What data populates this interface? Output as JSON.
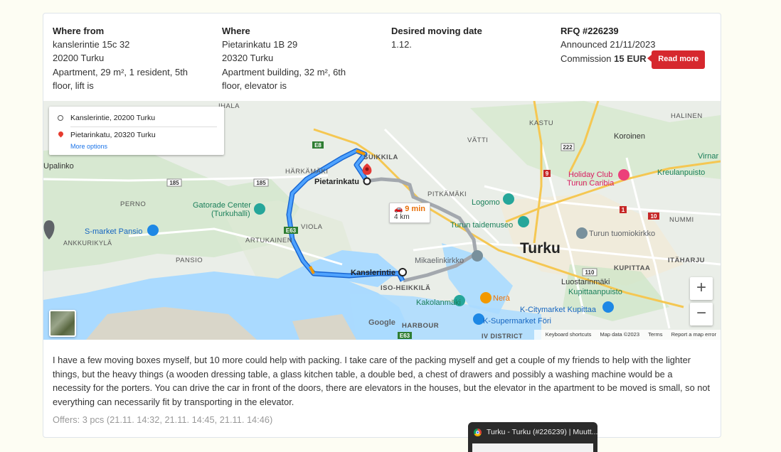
{
  "from": {
    "heading": "Where from",
    "street": "kanslerintie 15c 32",
    "city": "20200 Turku",
    "details": "Apartment, 29 m², 1 resident, 5th floor, lift is"
  },
  "to": {
    "heading": "Where",
    "street": "Pietarinkatu 1B 29",
    "city": "20320 Turku",
    "details": "Apartment building, 32 m², 6th floor, elevator is"
  },
  "date": {
    "heading": "Desired moving date",
    "value": "1.12."
  },
  "rfq": {
    "heading": "RFQ #226239",
    "announced": "Announced 21/11/2023",
    "commission_label": "Commission",
    "commission_value": "15 EUR",
    "read_more": "Read more"
  },
  "map": {
    "origin": "Kanslerintie, 20200 Turku",
    "destination": "Pietarinkatu, 20320 Turku",
    "more_options": "More options",
    "duration": "9 min",
    "distance": "4 km",
    "zoom_in": "+",
    "zoom_out": "−",
    "google": "Google",
    "footer": {
      "shortcuts": "Keyboard shortcuts",
      "data": "Map data ©2023",
      "terms": "Terms",
      "report": "Report a map error"
    },
    "labels": {
      "turku": "Turku",
      "kanslerintie": "Kanslerintie",
      "pietarinkatu": "Pietarinkatu",
      "kastu": "KASTU",
      "halinen": "HALINEN",
      "koroinen": "Koroinen",
      "vatti": "VÄTTI",
      "suikkila": "SUIKKILA",
      "harkamaki": "HÄRKÄMÄKI",
      "upalinko": "Upalinko",
      "perno": "PERNO",
      "gatorade": "Gatorade Center",
      "turkuhalli": "(Turkuhalli)",
      "viola": "VIOLA",
      "smarket": "S-market Pansio",
      "ankkurikyla": "ANKKURIKYLÄ",
      "artukainen": "ARTUKAINEN",
      "pansio": "PANSIO",
      "pitkamaki": "PITKÄMÄKI",
      "logomo": "Logomo",
      "taidemuseo": "Turun taidemuseo",
      "tuomiokirkko": "Turun tuomiokirkko",
      "nummi": "NUMMI",
      "holiday": "Holiday Club",
      "caribia": "Turun Caribia",
      "kreulanpuisto": "Kreulanpuisto",
      "virnamaki": "Virnar",
      "mikaelinkirkko": "Mikaelinkirkko",
      "iso_heikkila": "ISO-HEIKKILÄ",
      "kakolanmaki": "Kakolanmäki",
      "nera": "Nerà",
      "kcitymarket": "K-Citymarket Kupittaa",
      "ksupermarket": "K-Supermarket Föri",
      "luostarinmaki": "Luostarinmäki",
      "kupittaanpuisto": "Kupittaanpuisto",
      "kupittaa": "KUPITTAA",
      "itaharju": "ITÄHARJU",
      "harbour": "HARBOUR",
      "iv_district": "IV DISTRICT",
      "ihala": "IHALA",
      "r185a": "185",
      "r185b": "185",
      "r222": "222",
      "r110": "110",
      "e8": "E8",
      "e63a": "E63",
      "e63b": "E63",
      "r9": "9",
      "r10": "10",
      "r1": "1"
    }
  },
  "description": "I have a few moving boxes myself, but 10 more could help with packing. I take care of the packing myself and get a couple of my friends to help with the lighter things, but the heavy things (a wooden dressing table, a glass kitchen table, a double bed, a chest of drawers and possibly a washing machine would be a necessity for the porters. You can drive the car in front of the doors, there are elevators in the houses, but the elevator in the apartment to be moved is small, so not everything can necessarily fit by transporting in the elevator.",
  "offers": "Offers: 3 pcs (21.11. 14:32, 21.11. 14:45, 21.11. 14:46)",
  "tooltip": {
    "title": "Turku - Turku (#226239) | Muutt..."
  },
  "colors": {
    "route_primary": "#1a73e8",
    "route_alt": "#9aa0a6",
    "read_more_bg": "#d6282e",
    "commission_accent": "#d6282e"
  }
}
